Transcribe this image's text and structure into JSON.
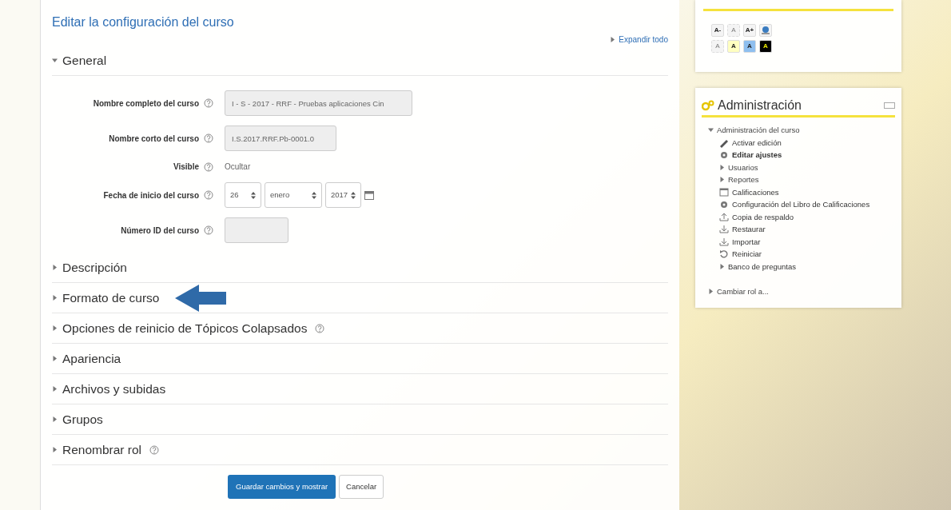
{
  "form": {
    "title": "Editar la configuración del curso",
    "expand_all": "Expandir todo",
    "sections": [
      {
        "title": "General",
        "expanded": true,
        "help": false,
        "highlighted": false,
        "fields": [
          {
            "label": "Nombre completo del curso",
            "kind": "text",
            "value": "I - S - 2017 - RRF - Pruebas aplicaciones Cin"
          },
          {
            "label": "Nombre corto del curso",
            "kind": "text",
            "value": "I.S.2017.RRF.Pb-0001.0"
          },
          {
            "label": "Visible",
            "kind": "static",
            "value": "Ocultar"
          },
          {
            "label": "Fecha de inicio del curso",
            "kind": "date",
            "day": "26",
            "month": "enero",
            "year": "2017"
          },
          {
            "label": "Número ID del curso",
            "kind": "text"
          }
        ]
      },
      {
        "title": "Descripción",
        "expanded": false,
        "help": false,
        "highlighted": false
      },
      {
        "title": "Formato de curso",
        "expanded": false,
        "help": false,
        "highlighted": true
      },
      {
        "title": "Opciones de reinicio de Tópicos Colapsados",
        "expanded": false,
        "help": true,
        "highlighted": false
      },
      {
        "title": "Apariencia",
        "expanded": false,
        "help": false,
        "highlighted": false
      },
      {
        "title": "Archivos y subidas",
        "expanded": false,
        "help": false,
        "highlighted": false
      },
      {
        "title": "Grupos",
        "expanded": false,
        "help": false,
        "highlighted": false
      },
      {
        "title": "Renombrar rol",
        "expanded": false,
        "help": true,
        "highlighted": false
      }
    ],
    "buttons": [
      {
        "label": "Guardar cambios y mostrar",
        "kind": "primary"
      },
      {
        "label": "Cancelar",
        "kind": "secondary"
      }
    ]
  },
  "accessibility": {
    "rows": [
      [
        {
          "label": "A-",
          "disabled": false,
          "color": "#f4f4f4"
        },
        {
          "label": "A",
          "disabled": true,
          "color": "#f4f4f4"
        },
        {
          "label": "A+",
          "disabled": false,
          "color": "#f4f4f4"
        },
        {
          "kind": "picture",
          "color": "#f4f4f4"
        }
      ],
      [
        {
          "label": "A",
          "disabled": true,
          "color": "#f4f4f4"
        },
        {
          "label": "A",
          "disabled": false,
          "color": "#ffffc0"
        },
        {
          "label": "A",
          "disabled": false,
          "color": "#8fbfef"
        },
        {
          "label": "A",
          "disabled": false,
          "color": "#000000"
        }
      ]
    ]
  },
  "admin": {
    "title": "Administración",
    "items": [
      {
        "label": "Administración del curso",
        "kind": "folder",
        "expanded": true,
        "link": false,
        "bold": false,
        "children": [
          {
            "label": "Activar edición",
            "kind": "pencil",
            "link": true,
            "bold": false
          },
          {
            "label": "Editar ajustes",
            "kind": "gear",
            "link": true,
            "bold": true
          },
          {
            "label": "Usuarios",
            "kind": "folder",
            "expanded": false,
            "link": false,
            "bold": false
          },
          {
            "label": "Reportes",
            "kind": "folder",
            "expanded": false,
            "link": false,
            "bold": false
          },
          {
            "label": "Calificaciones",
            "kind": "table",
            "link": true,
            "bold": false
          },
          {
            "label": "Configuración del Libro de Calificaciones",
            "kind": "gear",
            "link": true,
            "bold": false
          },
          {
            "label": "Copia de respaldo",
            "kind": "upload",
            "link": true,
            "bold": false
          },
          {
            "label": "Restaurar",
            "kind": "download",
            "link": true,
            "bold": false
          },
          {
            "label": "Importar",
            "kind": "download",
            "link": true,
            "bold": false
          },
          {
            "label": "Reiniciar",
            "kind": "reset",
            "link": true,
            "bold": false
          },
          {
            "label": "Banco de preguntas",
            "kind": "folder",
            "expanded": false,
            "link": true,
            "bold": false
          }
        ]
      },
      {
        "label": "Cambiar rol a...",
        "kind": "folder",
        "expanded": false,
        "link": false,
        "bold": false
      }
    ]
  }
}
